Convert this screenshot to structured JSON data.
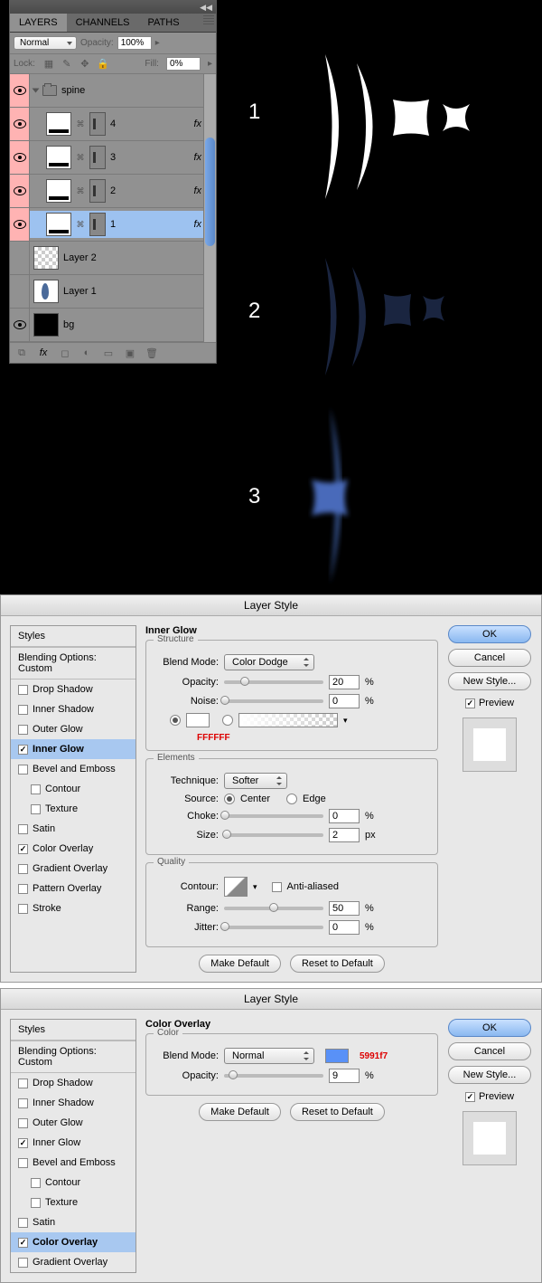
{
  "layersPanel": {
    "tabs": [
      "LAYERS",
      "CHANNELS",
      "PATHS"
    ],
    "blendMode": "Normal",
    "opacityLabel": "Opacity:",
    "opacity": "100%",
    "lockLabel": "Lock:",
    "fillLabel": "Fill:",
    "fill": "0%",
    "group": "spine",
    "layers": [
      {
        "name": "4",
        "fx": true,
        "pink": true
      },
      {
        "name": "3",
        "fx": true,
        "pink": true
      },
      {
        "name": "2",
        "fx": true,
        "pink": true
      },
      {
        "name": "1",
        "fx": true,
        "pink": true,
        "selected": true
      },
      {
        "name": "Layer 2",
        "fx": false,
        "pink": false,
        "checker": true,
        "noeye": true
      },
      {
        "name": "Layer 1",
        "fx": false,
        "pink": false,
        "blue": true,
        "noeye": true
      },
      {
        "name": "bg",
        "fx": false,
        "pink": false,
        "black": true
      }
    ]
  },
  "stage": {
    "n1": "1",
    "n2": "2",
    "n3": "3"
  },
  "dlg1": {
    "title": "Layer Style",
    "stylesHead": "Styles",
    "blending": "Blending Options: Custom",
    "items": [
      "Drop Shadow",
      "Inner Shadow",
      "Outer Glow",
      "Inner Glow",
      "Bevel and Emboss",
      "Contour",
      "Texture",
      "Satin",
      "Color Overlay",
      "Gradient Overlay",
      "Pattern Overlay",
      "Stroke"
    ],
    "section": "Inner Glow",
    "structure": "Structure",
    "blendModeLbl": "Blend Mode:",
    "blendMode": "Color Dodge",
    "opacityLbl": "Opacity:",
    "opacity": "20",
    "noiseLbl": "Noise:",
    "noise": "0",
    "hex": "FFFFFF",
    "elements": "Elements",
    "techLbl": "Technique:",
    "tech": "Softer",
    "srcLbl": "Source:",
    "center": "Center",
    "edge": "Edge",
    "chokeLbl": "Choke:",
    "choke": "0",
    "sizeLbl": "Size:",
    "size": "2",
    "px": "px",
    "quality": "Quality",
    "contourLbl": "Contour:",
    "aa": "Anti-aliased",
    "rangeLbl": "Range:",
    "range": "50",
    "jitterLbl": "Jitter:",
    "jitter": "0",
    "makeDef": "Make Default",
    "reset": "Reset to Default",
    "ok": "OK",
    "cancel": "Cancel",
    "newStyle": "New Style...",
    "preview": "Preview",
    "pct": "%"
  },
  "dlg2": {
    "title": "Layer Style",
    "stylesHead": "Styles",
    "blending": "Blending Options: Custom",
    "items": [
      "Drop Shadow",
      "Inner Shadow",
      "Outer Glow",
      "Inner Glow",
      "Bevel and Emboss",
      "Contour",
      "Texture",
      "Satin",
      "Color Overlay",
      "Gradient Overlay"
    ],
    "section": "Color Overlay",
    "color": "Color",
    "blendModeLbl": "Blend Mode:",
    "blendMode": "Normal",
    "hex": "5991f7",
    "opacityLbl": "Opacity:",
    "opacity": "9",
    "pct": "%",
    "makeDef": "Make Default",
    "reset": "Reset to Default",
    "ok": "OK",
    "cancel": "Cancel",
    "newStyle": "New Style...",
    "preview": "Preview"
  }
}
